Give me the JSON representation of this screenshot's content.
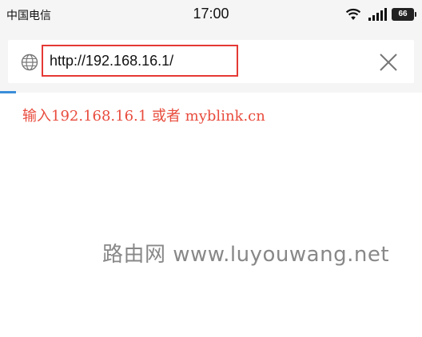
{
  "status_bar": {
    "carrier": "中国电信",
    "time": "17:00",
    "battery": "66"
  },
  "address_bar": {
    "url": "http://192.168.16.1/",
    "icons": {
      "left": "globe-icon",
      "right": "close-icon"
    },
    "highlight_color": "#e53935"
  },
  "content": {
    "hint": "输入192.168.16.1 或者 myblink.cn",
    "hint_color": "#e84c3d",
    "watermark": "路由网 www.luyouwang.net"
  }
}
